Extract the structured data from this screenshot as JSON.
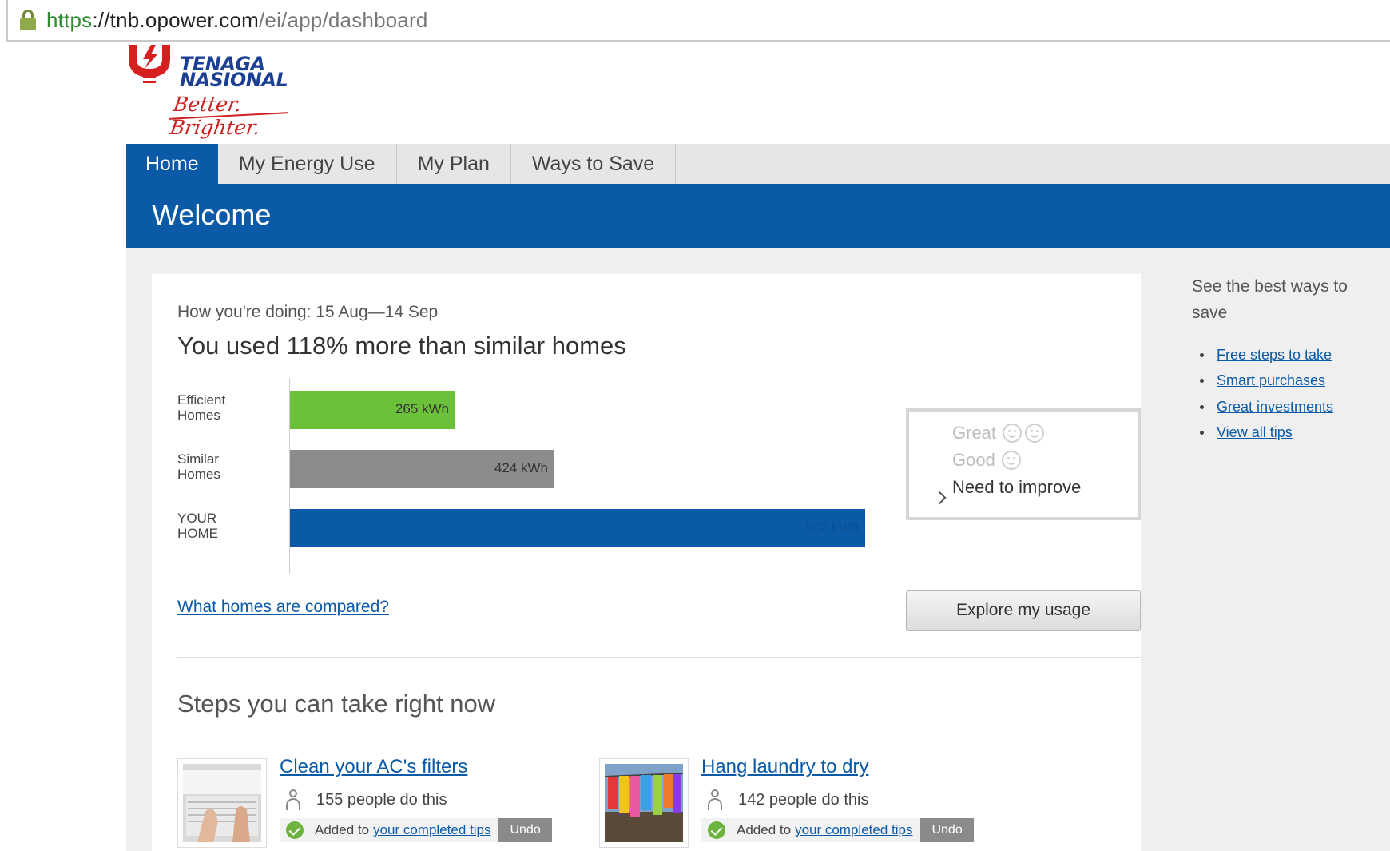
{
  "browser": {
    "url_scheme": "https",
    "url_host": "://tnb.opower.com",
    "url_path": "/ei/app/dashboard",
    "lock_icon": "lock-icon"
  },
  "logo": {
    "brand_line1": "TENAGA",
    "brand_line2": "NASIONAL",
    "tagline": "Better. Brighter.",
    "colors": {
      "brand": "#1b3f93",
      "accent": "#cc2222"
    }
  },
  "nav": {
    "tabs": [
      {
        "label": "Home",
        "active": true
      },
      {
        "label": "My Energy Use",
        "active": false
      },
      {
        "label": "My Plan",
        "active": false
      },
      {
        "label": "Ways to Save",
        "active": false
      }
    ]
  },
  "banner": {
    "title": "Welcome",
    "color": "#0a5aa8"
  },
  "summary": {
    "period": "How you're doing: 15 Aug—14 Sep",
    "headline": "You used 118% more than similar homes"
  },
  "chart_data": {
    "type": "bar",
    "orientation": "horizontal",
    "categories": [
      "Efficient Homes",
      "Similar Homes",
      "YOUR HOME"
    ],
    "category_lines": [
      [
        "Efficient",
        "Homes"
      ],
      [
        "Similar",
        "Homes"
      ],
      [
        "YOUR",
        "HOME"
      ]
    ],
    "values": [
      265,
      424,
      922
    ],
    "value_labels": [
      "265 kWh",
      "424 kWh",
      "922 kWh"
    ],
    "unit": "kWh",
    "colors": [
      "#6cc13a",
      "#8c8c8c",
      "#0a5aa8"
    ],
    "xlim": [
      0,
      922
    ]
  },
  "rating": {
    "great": "Great",
    "good": "Good",
    "need": "Need to improve",
    "selected": "Need to improve"
  },
  "links": {
    "compare": "What homes are compared?",
    "explore": "Explore my usage"
  },
  "steps": {
    "title": "Steps you can take right now",
    "tips": [
      {
        "title": "Clean your AC's filters",
        "people": "155 people do this",
        "added_prefix": "Added to",
        "added_link": "your completed tips",
        "undo": "Undo"
      },
      {
        "title": "Hang laundry to dry",
        "people": "142 people do this",
        "added_prefix": "Added to",
        "added_link": "your completed tips",
        "undo": "Undo"
      }
    ]
  },
  "sidebar": {
    "title": "See the best ways to save",
    "items": [
      "Free steps to take",
      "Smart purchases",
      "Great investments",
      "View all tips"
    ]
  }
}
